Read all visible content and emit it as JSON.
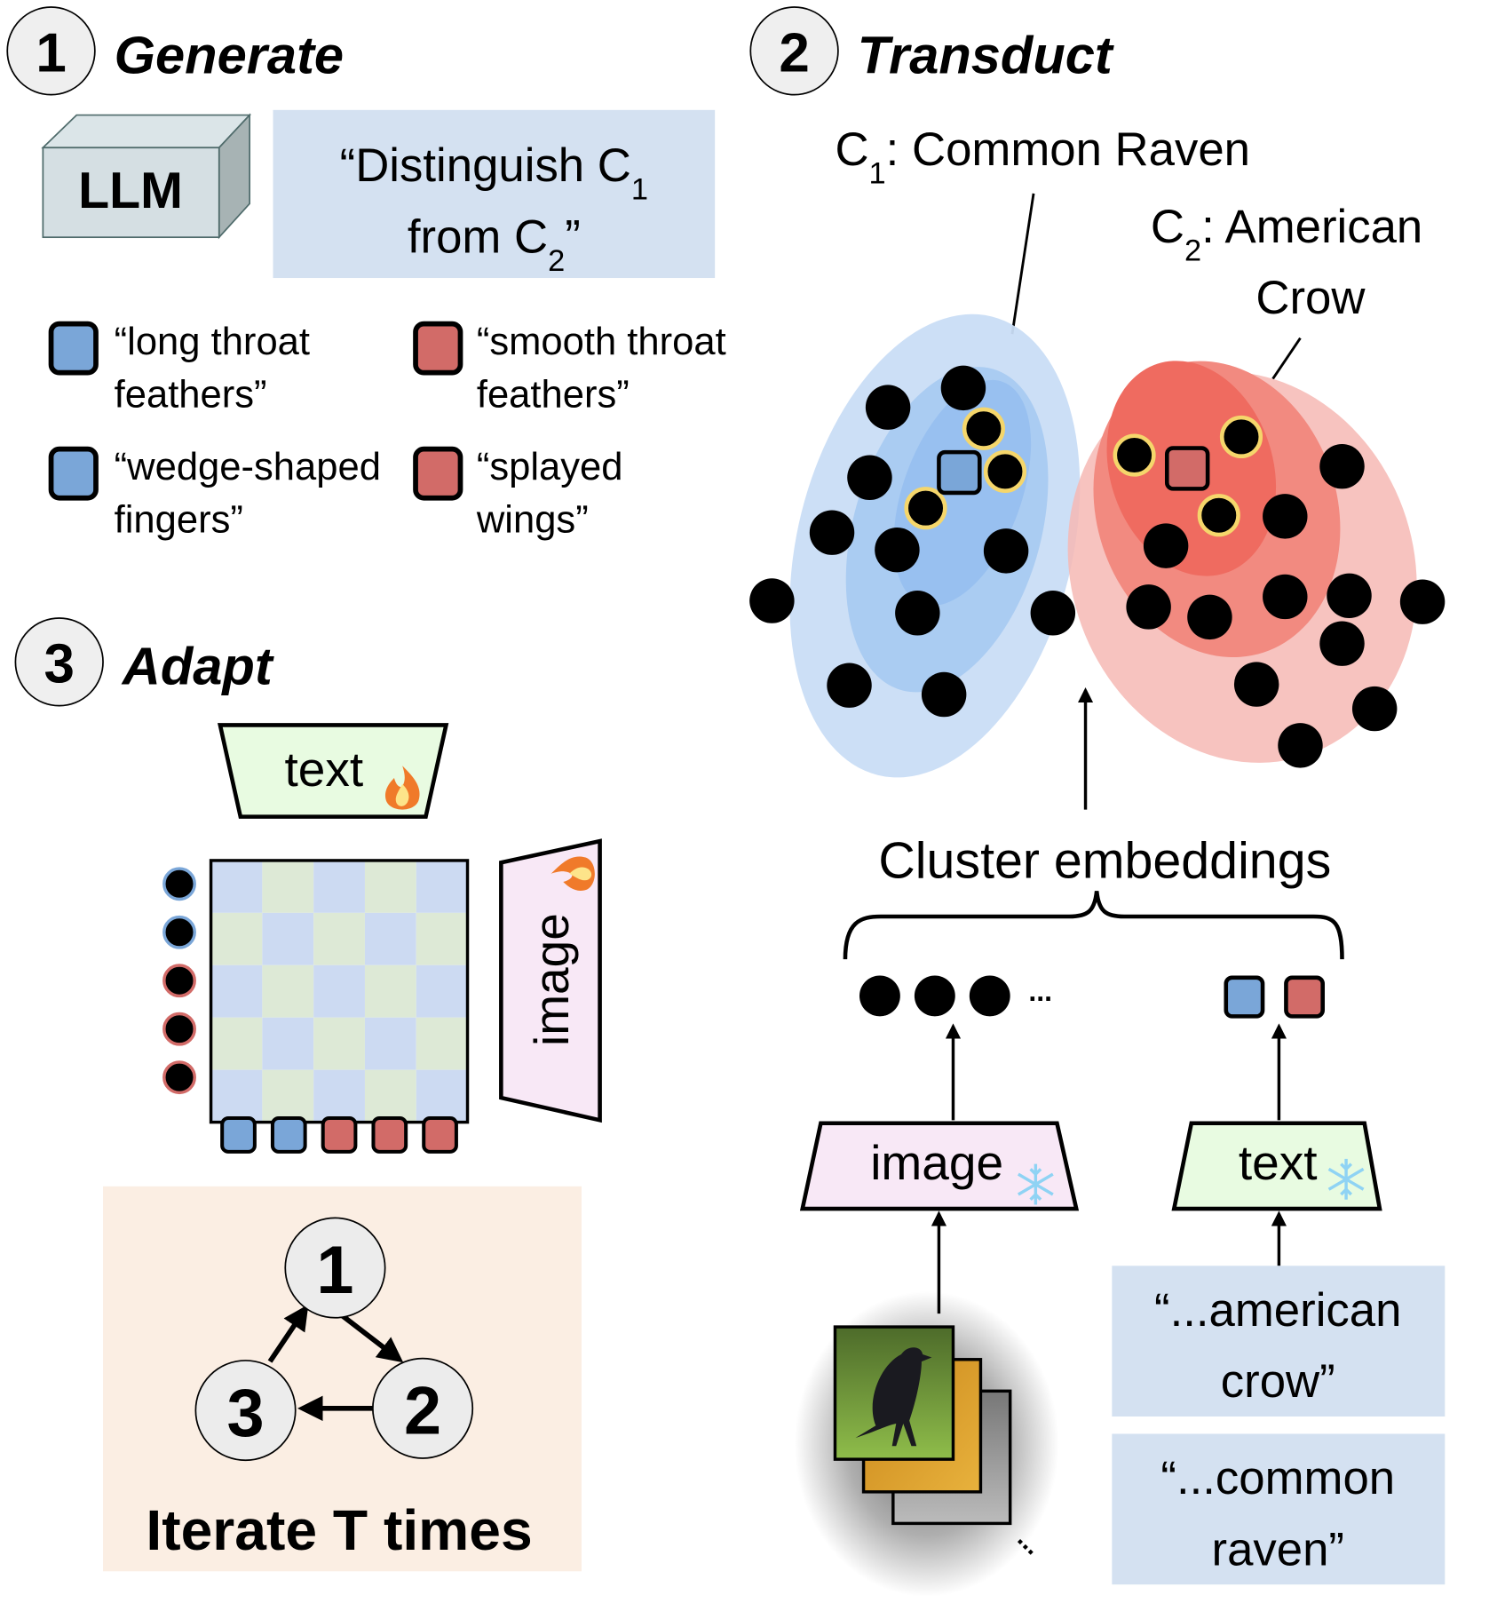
{
  "steps": {
    "generate": {
      "number": "1",
      "title": "Generate"
    },
    "transduct": {
      "number": "2",
      "title": "Transduct"
    },
    "adapt": {
      "number": "3",
      "title": "Adapt"
    }
  },
  "generate": {
    "llm_label": "LLM",
    "prompt_line1": "“Distinguish C",
    "prompt_sub1": "1",
    "prompt_line2": "from C",
    "prompt_sub2": "2",
    "prompt_close": "”",
    "attributes": [
      {
        "class": "C1",
        "line1": "“long throat",
        "line2": "feathers”",
        "color": "#7aa6d8"
      },
      {
        "class": "C2",
        "line1": "“smooth throat",
        "line2": "feathers”",
        "color": "#d26b68"
      },
      {
        "class": "C1",
        "line1": "“wedge-shaped",
        "line2": "fingers”",
        "color": "#7aa6d8"
      },
      {
        "class": "C2",
        "line1": "“splayed",
        "line2": "wings”",
        "color": "#d26b68"
      }
    ]
  },
  "transduct": {
    "c1_label_prefix": "C",
    "c1_sub": "1",
    "c1_name": ": Common Raven",
    "c2_label_prefix": "C",
    "c2_sub": "2",
    "c2_name_line1": ": American",
    "c2_name_line2": "Crow",
    "cluster_embeddings_label": "Cluster embeddings",
    "ellipsis": "...",
    "image_encoder_label": "image",
    "text_encoder_label": "text",
    "encoder_state_icon": "snowflake-icon",
    "text_prompts": [
      {
        "line1": "“...american",
        "line2": "crow”"
      },
      {
        "line1": "“...common",
        "line2": "raven”"
      }
    ],
    "image_stack_ellipsis": "..."
  },
  "adapt": {
    "text_encoder_label": "text",
    "image_encoder_label": "image",
    "encoder_state_icon": "fire-icon",
    "row_dot_classes": [
      "C1",
      "C1",
      "C2",
      "C2",
      "C2"
    ],
    "col_square_classes": [
      "C1",
      "C1",
      "C2",
      "C2",
      "C2"
    ]
  },
  "iterate": {
    "nodes": [
      "1",
      "2",
      "3"
    ],
    "label": "Iterate T times"
  },
  "colors": {
    "c1": "#7aa6d8",
    "c2": "#d26b68",
    "c1_ellipse_outer": "#c9ddf5",
    "c1_ellipse_mid": "#aaccf2",
    "c1_ellipse_inner": "#98c0f0",
    "c2_ellipse_outer": "#f6b8b4",
    "c2_ellipse_mid": "#f28a80",
    "c2_ellipse_inner": "#ef6b60",
    "highlight_ring": "#f5d66b",
    "prompt_box": "#d4e1f1",
    "iterate_box": "#fbeee3",
    "text_encoder": "#e8fbe1",
    "image_encoder": "#f8e8f6",
    "step_circle": "#efefef",
    "grid_blue": "#ccdaf2",
    "grid_green": "#dde9d6"
  }
}
